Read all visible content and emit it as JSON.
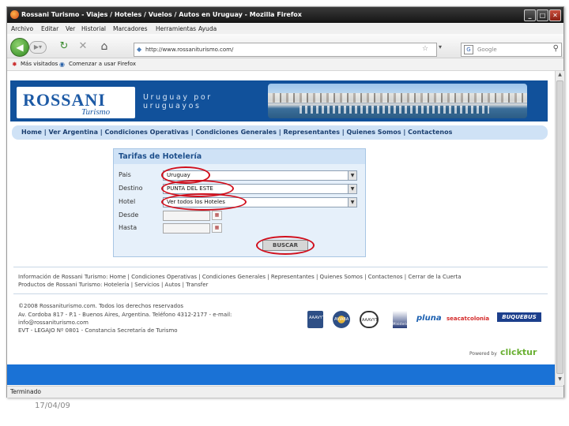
{
  "window": {
    "title": "Rossani Turismo - Viajes / Hoteles / Vuelos / Autos en Uruguay - Mozilla Firefox",
    "controls": [
      "_",
      "□",
      "✕"
    ]
  },
  "menubar": {
    "items": [
      "Archivo",
      "Editar",
      "Ver",
      "Historial",
      "Marcadores",
      "Herramientas",
      "Ayuda"
    ]
  },
  "navbar": {
    "url": "http://www.rossaniturismo.com/",
    "search_placeholder": "Google"
  },
  "bookmarks": {
    "items": [
      "Más visitados",
      "Comenzar a usar Firefox"
    ]
  },
  "site": {
    "logo_main": "ROSSANI",
    "logo_sub": "Turismo",
    "tagline_line1": "Uruguay por",
    "tagline_line2": "uruguayos",
    "nav": "Home | Ver Argentina | Condiciones Operativas | Condiciones Generales | Representantes | Quienes Somos | Contactenos"
  },
  "form": {
    "title": "Tarifas de Hotelería",
    "fields": [
      {
        "label": "Pais",
        "value": "Uruguay"
      },
      {
        "label": "Destino",
        "value": "PUNTA DEL ESTE"
      },
      {
        "label": "Hotel",
        "value": "Ver todos los Hoteles"
      },
      {
        "label": "Desde",
        "value": ""
      },
      {
        "label": "Hasta",
        "value": ""
      }
    ],
    "search_button": "BUSCAR"
  },
  "footer": {
    "links_line1": "Información de Rossani Turismo: Home | Condiciones Operativas | Condiciones Generales | Representantes | Quienes Somos | Contactenos | Cerrar de la Cuerta",
    "links_line2": "Productos de Rossani Turismo: Hotelería | Servicios | Autos | Transfer",
    "copyright": "©2008 Rossaniturismo.com. Todos los derechos reservados",
    "address": "Av. Cordoba 817 - P.1 - Buenos Aires, Argentina. Teléfono 4312-2177 - e-mail:",
    "email": "info@rossaniturismo.com",
    "license": "EVT - LEGAJO Nº 0801 - Constancia Secretaría de Turismo",
    "partners": [
      "AAAVYT",
      "AVIABA",
      "AAAVYT",
      "Ministerio",
      "pluna",
      "seacatcolonia",
      "BUQUEBUS"
    ],
    "powered_label": "Powered by",
    "powered_brand": "clicktur"
  },
  "status": {
    "text": "Terminado"
  },
  "slide": {
    "date": "17/04/09"
  }
}
